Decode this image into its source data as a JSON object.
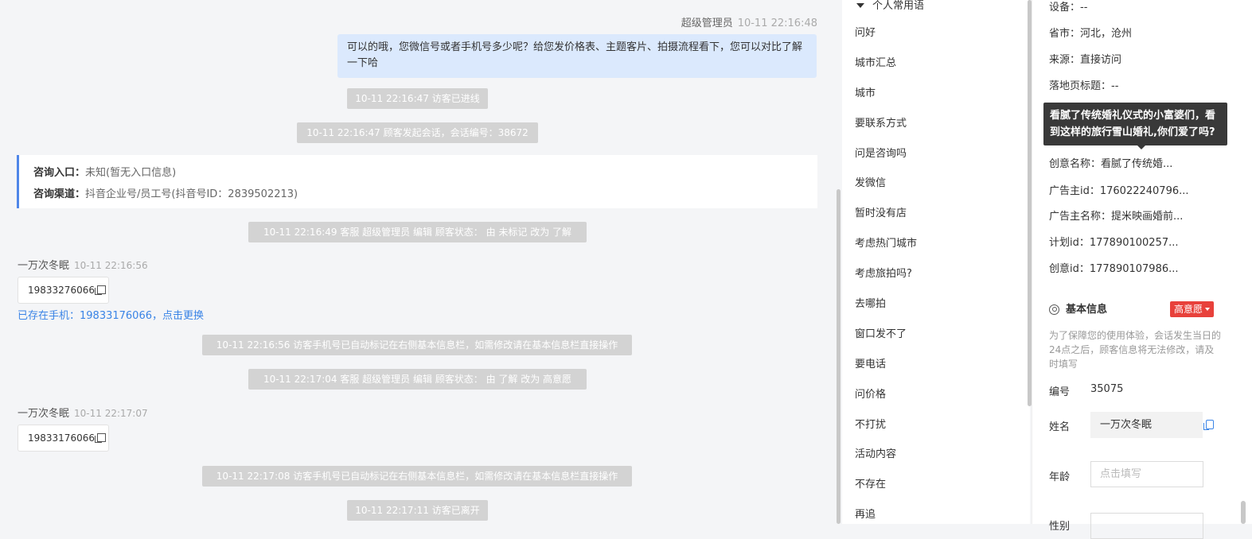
{
  "chat": {
    "agent_msg": {
      "sender": "超级管理员",
      "time": "10-11 22:16:48",
      "text": "可以的哦，您微信号或者手机号多少呢？给您发价格表、主题客片、拍摄流程看下，您可以对比了解一下哈"
    },
    "sys_visitor_entered": "10-11 22:16:47 访客已进线",
    "sys_session_started": "10-11 22:16:47 顾客发起会话，会话编号：38672",
    "consult_card": {
      "entry_label": "咨询入口：",
      "entry_value": "未知(暂无入口信息)",
      "channel_label": "咨询渠道：",
      "channel_value": "抖音企业号/员工号(抖音号ID：2839502213)"
    },
    "sys_status_1": "10-11 22:16:49 客服 超级管理员 编辑 顾客状态： 由 未标记 改为 了解",
    "visitor_msg_1": {
      "name": "一万次冬眠",
      "time": "10-11 22:16:56",
      "phone": "19833276066"
    },
    "exists_link": "已存在手机：19833176066，点击更换",
    "sys_auto_mark_1": "10-11 22:16:56 访客手机号已自动标记在右侧基本信息栏，如需修改请在基本信息栏直接操作",
    "sys_status_2": "10-11 22:17:04 客服 超级管理员 编辑 顾客状态： 由 了解 改为 高意愿",
    "visitor_msg_2": {
      "name": "一万次冬眠",
      "time": "10-11 22:17:07",
      "phone": "19833176066"
    },
    "sys_auto_mark_2": "10-11 22:17:08 访客手机号已自动标记在右侧基本信息栏，如需修改请在基本信息栏直接操作",
    "sys_visitor_left": "10-11 22:17:11 访客已离开"
  },
  "phrases": {
    "header": "个人常用语",
    "items": [
      "问好",
      "城市汇总",
      "城市",
      "要联系方式",
      "问是咨询吗",
      "发微信",
      "暂时没有店",
      "考虑热门城市",
      "考虑旅拍吗?",
      "去哪拍",
      "窗口发不了",
      "要电话",
      "问价格",
      "不打扰",
      "活动内容",
      "不存在",
      "再追"
    ]
  },
  "info": {
    "device": "设备：--",
    "province_city": "省市：河北，沧州",
    "source": "来源：直接访问",
    "landing_title": "落地页标题：--",
    "tooltip": "看腻了传统婚礼仪式的小富婆们，看到这样的旅行雪山婚礼,你们爱了吗?",
    "creative_name": "创意名称：看腻了传统婚...",
    "advertiser_id": "广告主id：176022240796...",
    "advertiser_name": "广告主名称：提米映画婚前...",
    "plan_id": "计划id：177890100257...",
    "creative_id": "创意id：177890107986...",
    "basic_title": "基本信息",
    "intent_badge": "高意愿",
    "notice": "为了保障您的使用体验，会话发生当日的24点之后，顾客信息将无法修改，请及时填写",
    "id_label": "编号",
    "id_value": "35075",
    "name_label": "姓名",
    "name_value": "一万次冬眠",
    "age_label": "年龄",
    "age_placeholder": "点击填写",
    "gender_label": "性别"
  }
}
